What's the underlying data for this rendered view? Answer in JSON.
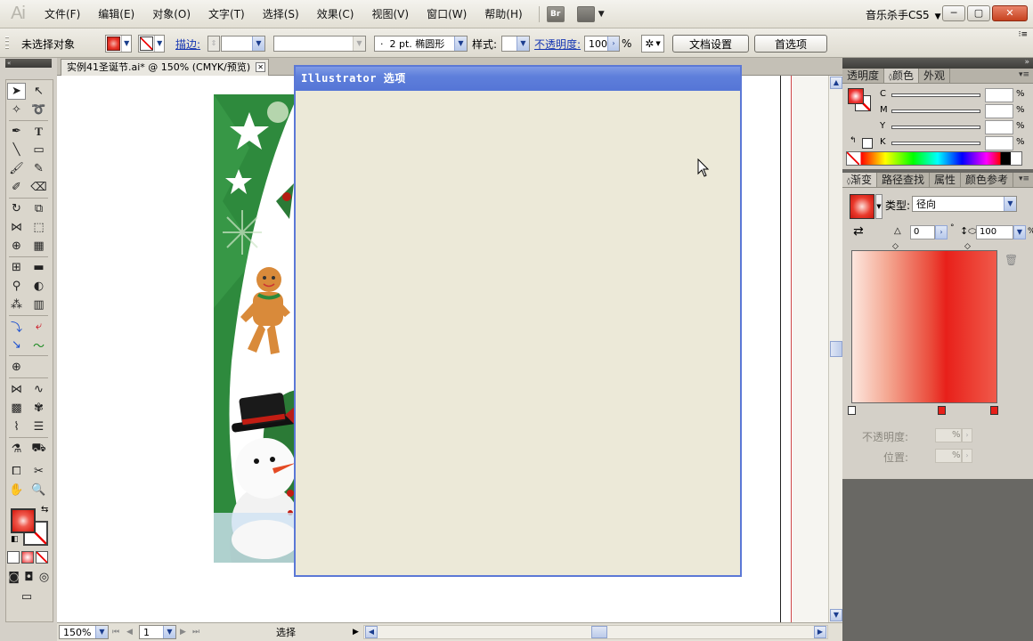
{
  "app": {
    "logo": "Ai"
  },
  "menu": {
    "items": [
      "文件(F)",
      "编辑(E)",
      "对象(O)",
      "文字(T)",
      "选择(S)",
      "效果(C)",
      "视图(V)",
      "窗口(W)",
      "帮助(H)"
    ],
    "bridge": "Br",
    "workspace": "音乐杀手CS5"
  },
  "window_buttons": {
    "minimize": "─",
    "restore": "▢",
    "close": "✕"
  },
  "control": {
    "selection_status": "未选择对象",
    "stroke_label": "描边:",
    "brush_value": "2 pt. 椭圆形",
    "brush_dot": "·",
    "style_label": "样式:",
    "opacity_label": "不透明度:",
    "opacity_value": "100",
    "opacity_unit": "%",
    "doc_setup": "文档设置",
    "preferences": "首选项"
  },
  "document": {
    "tab_title": "实例41圣诞节.ai* @ 150% (CMYK/预览)",
    "zoom": "150%",
    "artboard": "1",
    "status": "选择"
  },
  "dialog": {
    "title": "Illustrator 选项"
  },
  "color_panel": {
    "tabs": [
      "透明度",
      "颜色",
      "外观"
    ],
    "active_tab": "颜色",
    "channels": [
      "C",
      "M",
      "Y",
      "K"
    ],
    "unit": "%"
  },
  "gradient_panel": {
    "tabs": [
      "渐变",
      "路径查找",
      "属性",
      "颜色参考"
    ],
    "type_label": "类型:",
    "type_value": "径向",
    "angle_value": "0",
    "angle_unit": "°",
    "aspect_value": "100",
    "aspect_unit": "%",
    "opacity_label": "不透明度:",
    "location_label": "位置:",
    "unit": "%",
    "stop_colors": [
      "#ffffff",
      "#e8201a",
      "#e8201a"
    ]
  },
  "colors": {
    "accent_blue": "#5575d6",
    "fill_red": "#e8362b",
    "link_blue": "#1536b3"
  }
}
